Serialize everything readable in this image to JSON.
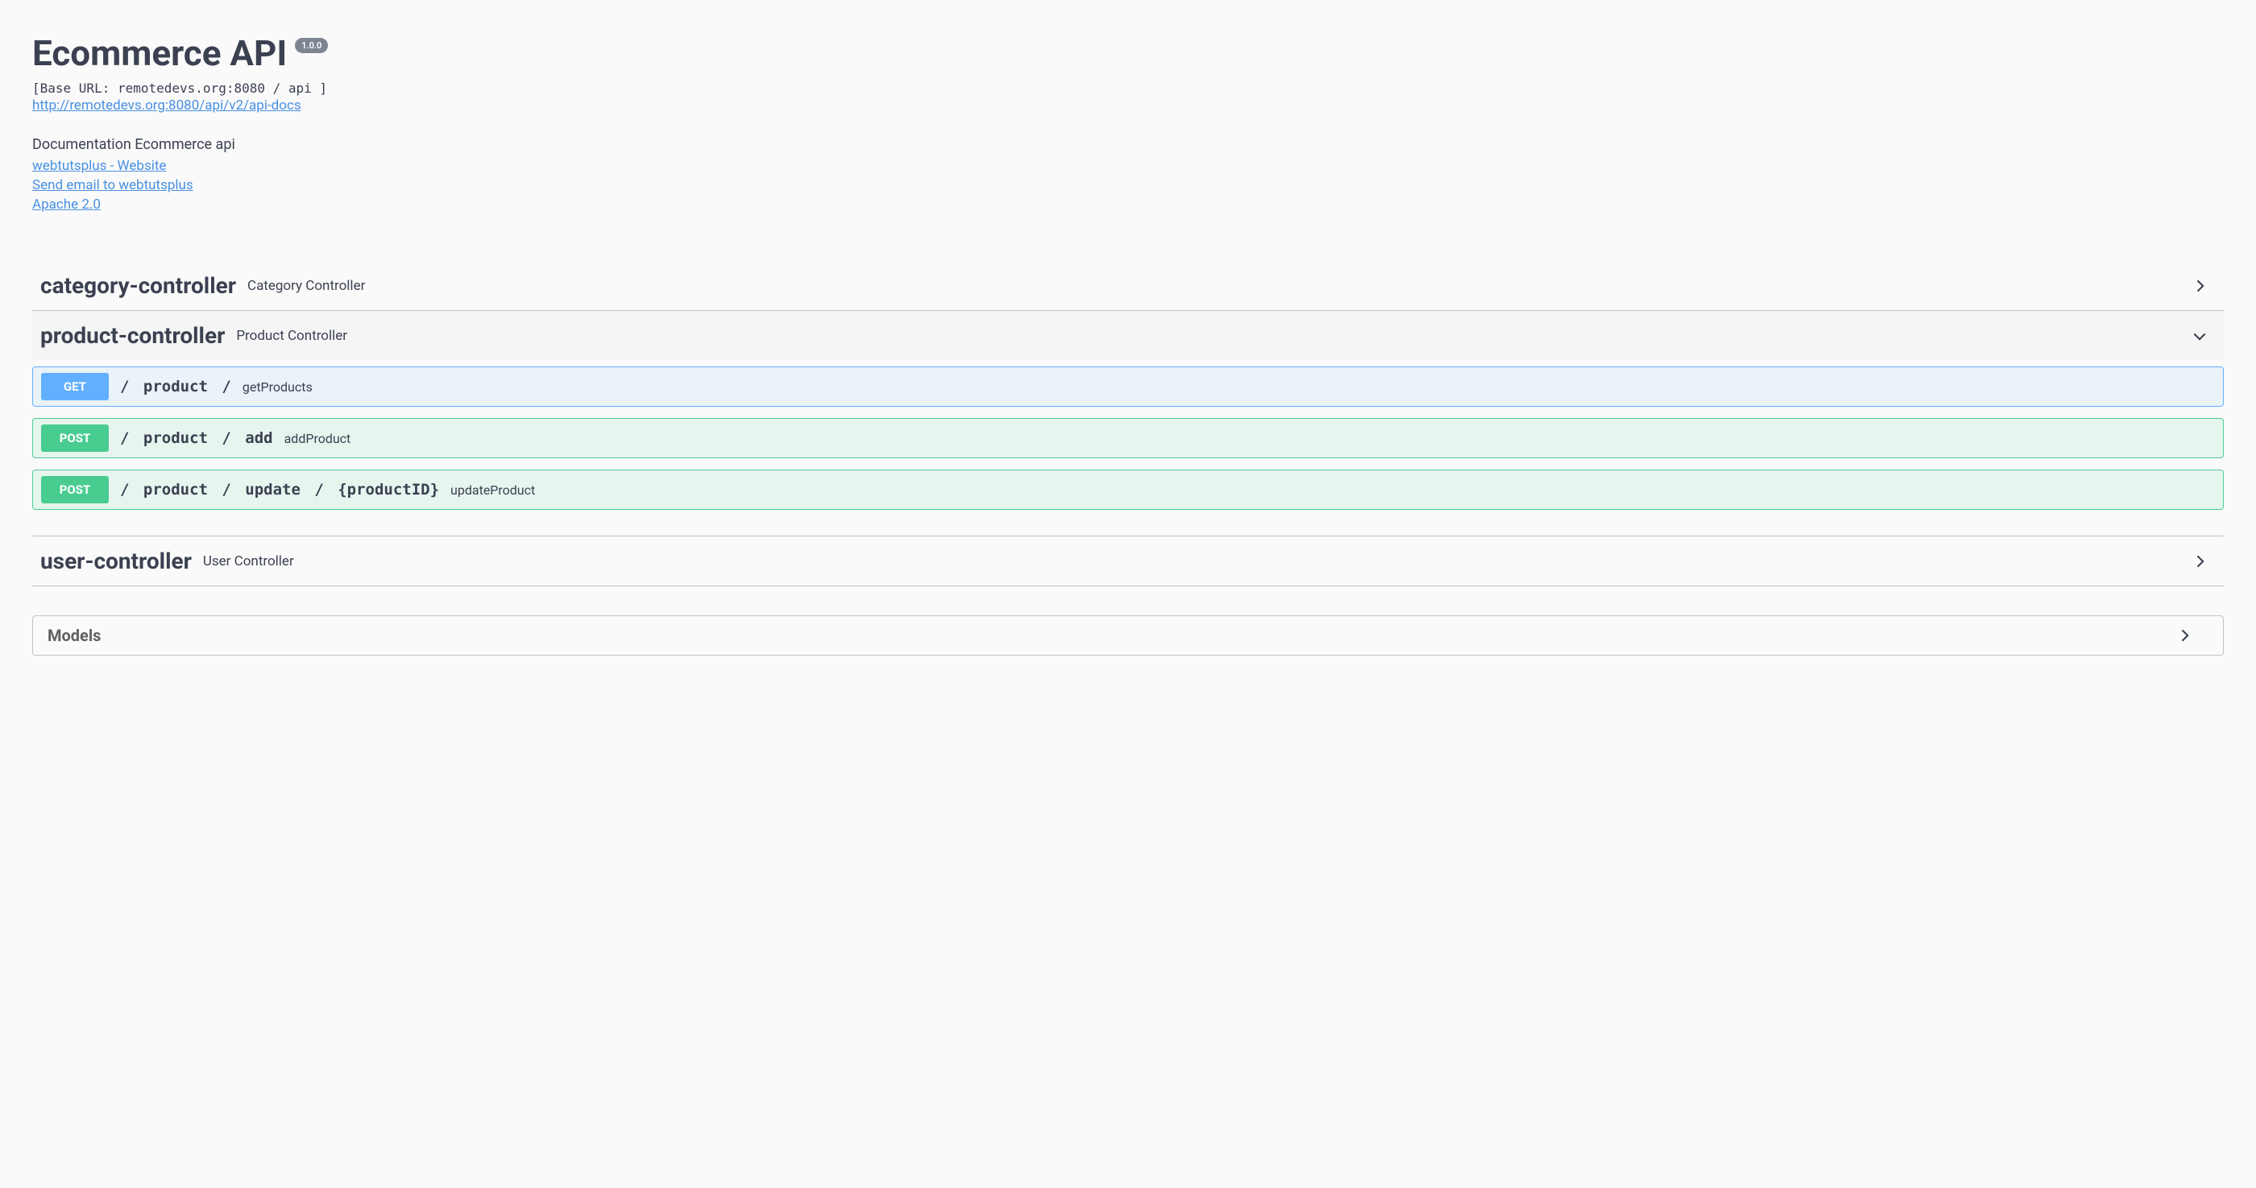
{
  "info": {
    "title": "Ecommerce API",
    "version": "1.0.0",
    "base_url_label": "[Base URL: remotedevs.org:8080 / api ]",
    "docs_url": "http://remotedevs.org:8080/api/v2/api-docs",
    "description": "Documentation Ecommerce api",
    "contact_website": "webtutsplus - Website",
    "contact_email": "Send email to webtutsplus",
    "license": "Apache 2.0"
  },
  "tags": [
    {
      "name": "category-controller",
      "description": "Category Controller",
      "expanded": false
    },
    {
      "name": "product-controller",
      "description": "Product Controller",
      "expanded": true
    },
    {
      "name": "user-controller",
      "description": "User Controller",
      "expanded": false
    }
  ],
  "product_ops": [
    {
      "method": "GET",
      "path": "/ product /",
      "summary": "getProducts"
    },
    {
      "method": "POST",
      "path": "/ product / add",
      "summary": "addProduct"
    },
    {
      "method": "POST",
      "path": "/ product / update / {productID}",
      "summary": "updateProduct"
    }
  ],
  "models_label": "Models"
}
